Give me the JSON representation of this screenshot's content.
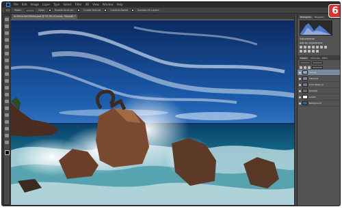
{
  "app": {
    "menu": [
      "Ps",
      "File",
      "Edit",
      "Image",
      "Layer",
      "Type",
      "Select",
      "Filter",
      "3D",
      "View",
      "Window",
      "Help"
    ],
    "document_tab": "la-Peine-del-Viento.psd @ 33.3% (Curves, Mask/8) *"
  },
  "options_bar": {
    "mode_label": "Mode:",
    "mode_value": "Normal",
    "opacity_label": "Opac:",
    "auto_label": "Enable Airbrush",
    "create_texture": "Create Texture",
    "content_aware": "Content-Aware",
    "sample_all": "Sample All Layers"
  },
  "panels": {
    "top_tabs": [
      "Histogram",
      "Navigator"
    ],
    "adjustments_title": "Adjustments",
    "adjustments_subtitle": "Add an adjustment",
    "layers_tabs": [
      "Layers",
      "Channels",
      "Paths"
    ],
    "layers": [
      {
        "name": "Curves",
        "selected": true,
        "thumb": "#9ab"
      },
      {
        "name": "Vibrance",
        "selected": false,
        "thumb": "#889"
      },
      {
        "name": "Color Balance",
        "selected": false,
        "thumb": "#778"
      },
      {
        "name": "Hue/Sat",
        "selected": false,
        "thumb": "#667"
      },
      {
        "name": "Levels",
        "selected": false,
        "thumb": "#fff"
      },
      {
        "name": "Background",
        "selected": false,
        "thumb": "#2d5f9a"
      }
    ]
  },
  "step_badge": "6",
  "colors": {
    "accent": "#d8322a",
    "ui_dark": "#3a3a3a",
    "panel": "#535353"
  }
}
